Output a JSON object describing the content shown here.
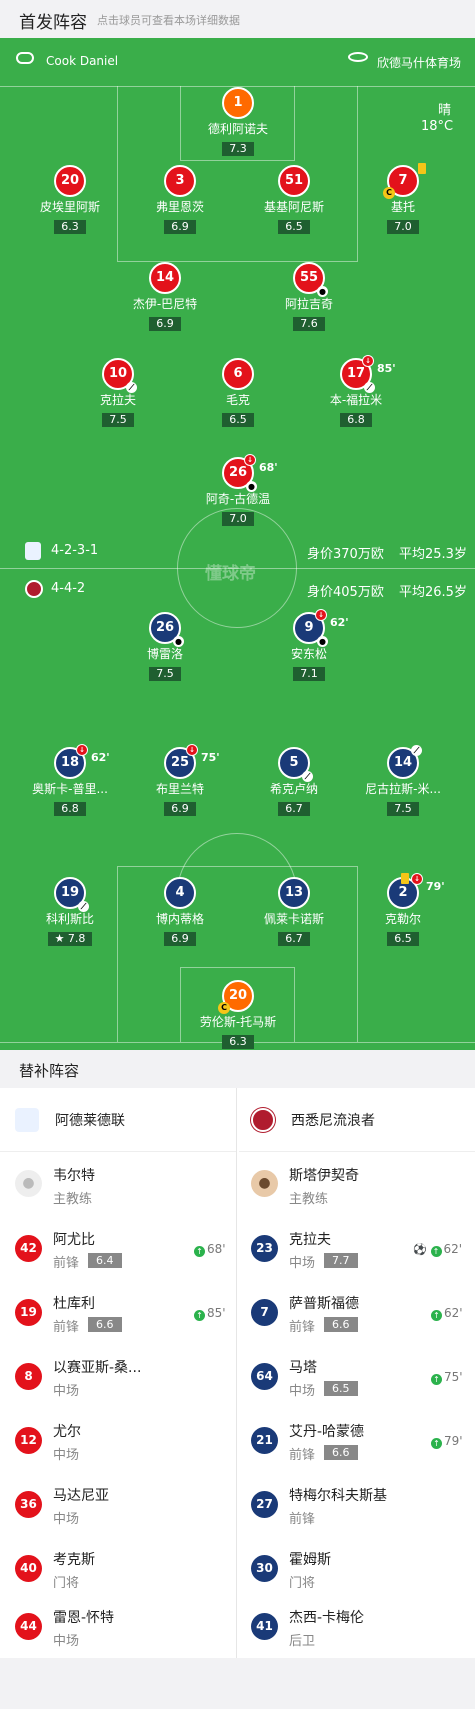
{
  "header": {
    "title": "首发阵容",
    "subtitle": "点击球员可查看本场详细数据"
  },
  "match": {
    "referee": "Cook Daniel",
    "stadium": "欣德马什体育场",
    "weather": "晴",
    "temperature": "18°C",
    "watermark": "懂球帝"
  },
  "home": {
    "name": "阿德莱德联",
    "formation": "4-2-3-1",
    "value": "身价370万欧",
    "avg_age": "平均25.3岁",
    "color": "#e3121b",
    "players": [
      {
        "num": "1",
        "name": "德利阿诺夫",
        "rating": "7.3"
      },
      {
        "num": "20",
        "name": "皮埃里阿斯",
        "rating": "6.3"
      },
      {
        "num": "3",
        "name": "弗里恩茨",
        "rating": "6.9"
      },
      {
        "num": "51",
        "name": "基基阿尼斯",
        "rating": "6.5"
      },
      {
        "num": "7",
        "name": "基托",
        "rating": "7.0"
      },
      {
        "num": "14",
        "name": "杰伊-巴尼特",
        "rating": "6.9"
      },
      {
        "num": "55",
        "name": "阿拉吉奇",
        "rating": "7.6"
      },
      {
        "num": "10",
        "name": "克拉夫",
        "rating": "7.5"
      },
      {
        "num": "6",
        "name": "毛克",
        "rating": "6.5"
      },
      {
        "num": "17",
        "name": "本-福拉米",
        "rating": "6.8",
        "sub": "85'"
      },
      {
        "num": "26",
        "name": "阿奇-古德温",
        "rating": "7.0",
        "sub": "68'"
      }
    ]
  },
  "away": {
    "name": "西悉尼流浪者",
    "formation": "4-4-2",
    "value": "身价405万欧",
    "avg_age": "平均26.5岁",
    "color": "#1a3a78",
    "players": [
      {
        "num": "26",
        "name": "博雷洛",
        "rating": "7.5"
      },
      {
        "num": "9",
        "name": "安东松",
        "rating": "7.1",
        "sub": "62'"
      },
      {
        "num": "18",
        "name": "奥斯卡-普里...",
        "rating": "6.8",
        "sub": "62'"
      },
      {
        "num": "25",
        "name": "布里兰特",
        "rating": "6.9",
        "sub": "75'"
      },
      {
        "num": "5",
        "name": "希克卢纳",
        "rating": "6.7"
      },
      {
        "num": "14",
        "name": "尼古拉斯-米...",
        "rating": "7.5"
      },
      {
        "num": "19",
        "name": "科利斯比",
        "rating": "7.8"
      },
      {
        "num": "4",
        "name": "博内蒂格",
        "rating": "6.9"
      },
      {
        "num": "13",
        "name": "佩莱卡诺斯",
        "rating": "6.7"
      },
      {
        "num": "2",
        "name": "克勒尔",
        "rating": "6.5",
        "sub": "79'"
      },
      {
        "num": "20",
        "name": "劳伦斯-托马斯",
        "rating": "6.3"
      }
    ]
  },
  "subs_title": "替补阵容",
  "home_bench": {
    "coach": {
      "name": "韦尔特",
      "role": "主教练"
    },
    "players": [
      {
        "num": "42",
        "name": "阿尤比",
        "pos": "前锋",
        "rating": "6.4",
        "in": "68'"
      },
      {
        "num": "19",
        "name": "杜库利",
        "pos": "前锋",
        "rating": "6.6",
        "in": "85'"
      },
      {
        "num": "8",
        "name": "以赛亚斯-桑...",
        "pos": "中场"
      },
      {
        "num": "12",
        "name": "尤尔",
        "pos": "中场"
      },
      {
        "num": "36",
        "name": "马达尼亚",
        "pos": "中场"
      },
      {
        "num": "40",
        "name": "考克斯",
        "pos": "门将"
      },
      {
        "num": "44",
        "name": "雷恩-怀特",
        "pos": "中场"
      }
    ]
  },
  "away_bench": {
    "coach": {
      "name": "斯塔伊契奇",
      "role": "主教练"
    },
    "players": [
      {
        "num": "23",
        "name": "克拉夫",
        "pos": "中场",
        "rating": "7.7",
        "in": "62'"
      },
      {
        "num": "7",
        "name": "萨普斯福德",
        "pos": "前锋",
        "rating": "6.6",
        "in": "62'"
      },
      {
        "num": "64",
        "name": "马塔",
        "pos": "中场",
        "rating": "6.5",
        "in": "75'"
      },
      {
        "num": "21",
        "name": "艾丹-哈蒙德",
        "pos": "前锋",
        "rating": "6.6",
        "in": "79'"
      },
      {
        "num": "27",
        "name": "特梅尔科夫斯基",
        "pos": "前锋"
      },
      {
        "num": "30",
        "name": "霍姆斯",
        "pos": "门将"
      },
      {
        "num": "41",
        "name": "杰西-卡梅伦",
        "pos": "后卫"
      }
    ]
  }
}
